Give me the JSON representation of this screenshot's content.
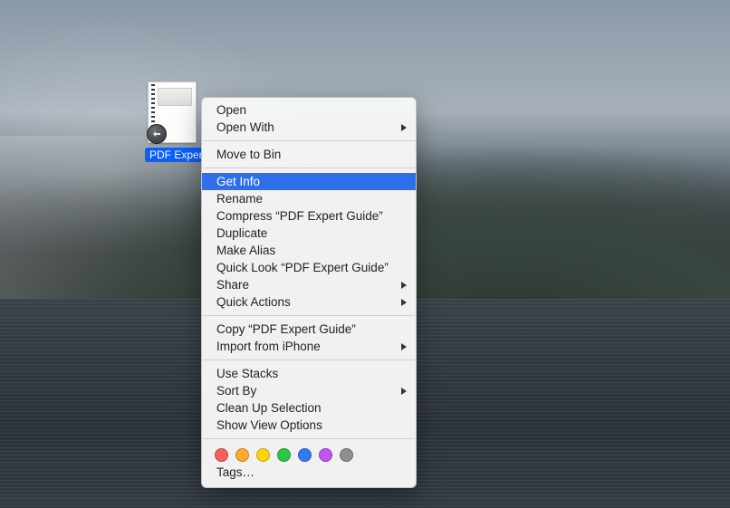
{
  "file": {
    "label": "PDF Expert Guide"
  },
  "menu": {
    "groups": [
      [
        {
          "label": "Open",
          "submenu": false
        },
        {
          "label": "Open With",
          "submenu": true
        }
      ],
      [
        {
          "label": "Move to Bin",
          "submenu": false
        }
      ],
      [
        {
          "label": "Get Info",
          "submenu": false,
          "highlighted": true
        },
        {
          "label": "Rename",
          "submenu": false
        },
        {
          "label": "Compress “PDF Expert Guide”",
          "submenu": false
        },
        {
          "label": "Duplicate",
          "submenu": false
        },
        {
          "label": "Make Alias",
          "submenu": false
        },
        {
          "label": "Quick Look “PDF Expert Guide”",
          "submenu": false
        },
        {
          "label": "Share",
          "submenu": true
        },
        {
          "label": "Quick Actions",
          "submenu": true
        }
      ],
      [
        {
          "label": "Copy “PDF Expert Guide”",
          "submenu": false
        },
        {
          "label": "Import from iPhone",
          "submenu": true
        }
      ],
      [
        {
          "label": "Use Stacks",
          "submenu": false
        },
        {
          "label": "Sort By",
          "submenu": true
        },
        {
          "label": "Clean Up Selection",
          "submenu": false
        },
        {
          "label": "Show View Options",
          "submenu": false
        }
      ]
    ],
    "tags": {
      "colors": [
        "#ff5f57",
        "#ffab2e",
        "#ffd60a",
        "#28c840",
        "#3478f6",
        "#c154f5",
        "#8e8e93"
      ],
      "label": "Tags…"
    }
  }
}
